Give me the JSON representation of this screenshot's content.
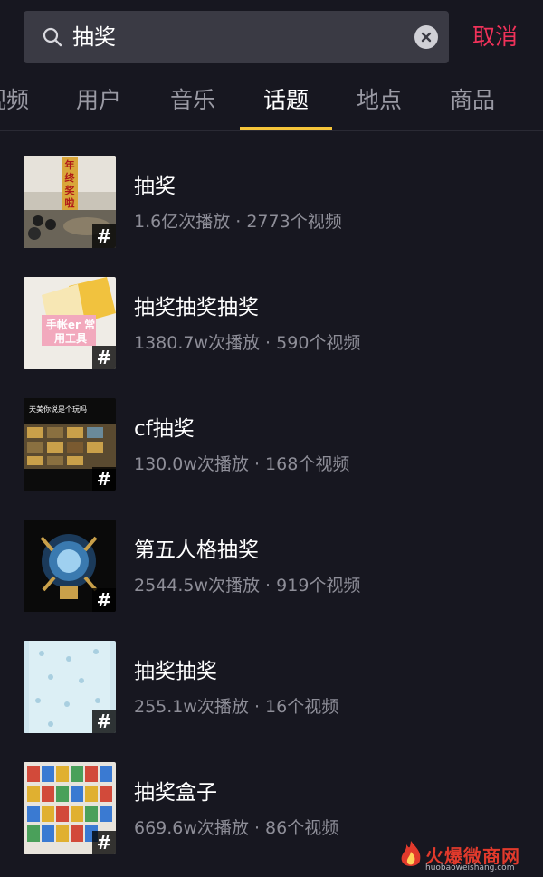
{
  "search": {
    "query": "抽奖",
    "cancel_label": "取消"
  },
  "tabs": [
    {
      "label": "视频"
    },
    {
      "label": "用户"
    },
    {
      "label": "音乐"
    },
    {
      "label": "话题",
      "active": true
    },
    {
      "label": "地点"
    },
    {
      "label": "商品"
    }
  ],
  "topics": [
    {
      "title": "抽奖",
      "stats": "1.6亿次播放 · 2773个视频",
      "thumb_text": "年终奖啦"
    },
    {
      "title": "抽奖抽奖抽奖",
      "stats": "1380.7w次播放 · 590个视频",
      "thumb_text": "手帐er 常用工具"
    },
    {
      "title": "cf抽奖",
      "stats": "130.0w次播放 · 168个视频",
      "thumb_text": "天美你说是个玩吗"
    },
    {
      "title": "第五人格抽奖",
      "stats": "2544.5w次播放 · 919个视频"
    },
    {
      "title": "抽奖抽奖",
      "stats": "255.1w次播放 · 16个视频"
    },
    {
      "title": "抽奖盒子",
      "stats": "669.6w次播放 · 86个视频"
    }
  ],
  "badge_symbol": "#",
  "watermark": {
    "text": "火爆微商网",
    "url": "huobaoweishang.com"
  },
  "colors": {
    "background": "#171720",
    "accent_cancel": "#f0325a",
    "tab_underline": "#f6c53a",
    "secondary_text": "#8e8e98"
  }
}
